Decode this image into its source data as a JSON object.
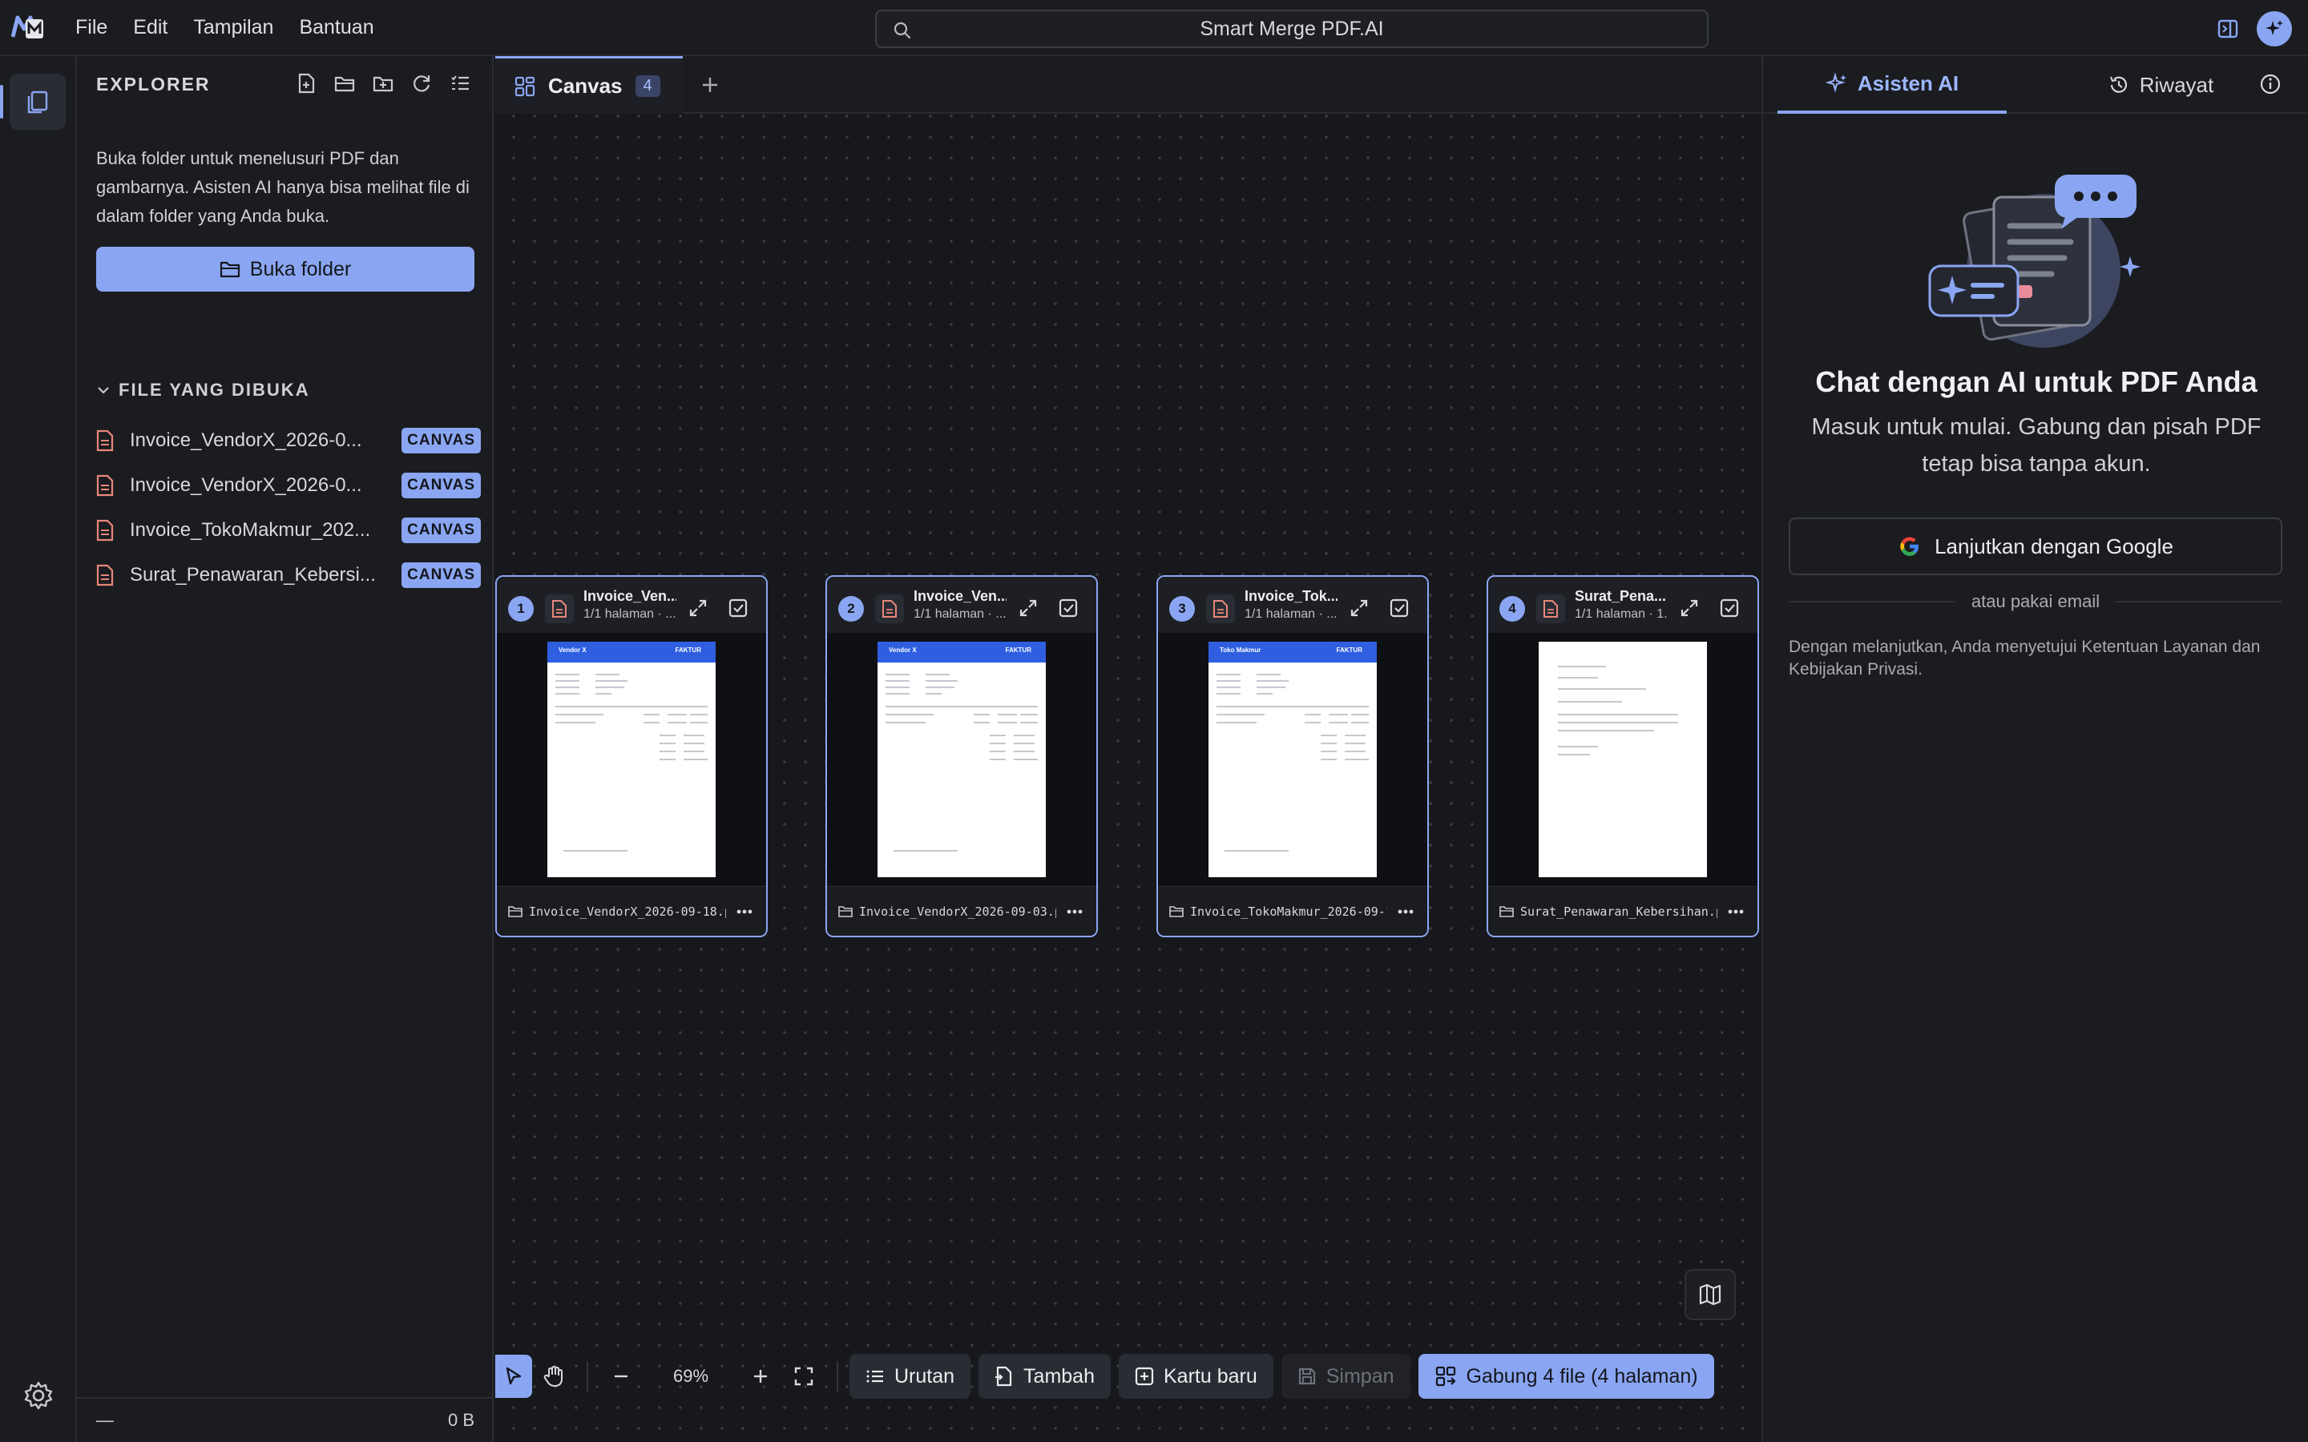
{
  "menu": {
    "items": [
      "File",
      "Edit",
      "Tampilan",
      "Bantuan"
    ]
  },
  "search": {
    "label": "Smart Merge PDF.AI"
  },
  "explorer": {
    "title": "EXPLORER",
    "description": "Buka folder untuk menelusuri PDF dan gambarnya. Asisten AI hanya bisa melihat file di dalam folder yang Anda buka.",
    "open_button": "Buka folder",
    "section_title": "FILE YANG DIBUKA",
    "files": [
      {
        "name": "Invoice_VendorX_2026-0...",
        "badge": "CANVAS"
      },
      {
        "name": "Invoice_VendorX_2026-0...",
        "badge": "CANVAS"
      },
      {
        "name": "Invoice_TokoMakmur_202...",
        "badge": "CANVAS"
      },
      {
        "name": "Surat_Penawaran_Kebersi...",
        "badge": "CANVAS"
      }
    ],
    "status_left": "—",
    "status_right": "0 B"
  },
  "canvas": {
    "tab_label": "Canvas",
    "tab_count": "4",
    "cards": [
      {
        "num": "1",
        "title": "Invoice_Ven...",
        "sub": "1/1 halaman · ...",
        "file": "Invoice_VendorX_2026-09-18.p...",
        "kind": "invoice",
        "brand": "Vendor X",
        "doc": "FAKTUR"
      },
      {
        "num": "2",
        "title": "Invoice_Ven...",
        "sub": "1/1 halaman · ...",
        "file": "Invoice_VendorX_2026-09-03.p...",
        "kind": "invoice",
        "brand": "Vendor X",
        "doc": "FAKTUR"
      },
      {
        "num": "3",
        "title": "Invoice_Tok...",
        "sub": "1/1 halaman · ...",
        "file": "Invoice_TokoMakmur_2026-09-1...",
        "kind": "invoice",
        "brand": "Toko Makmur",
        "doc": "FAKTUR"
      },
      {
        "num": "4",
        "title": "Surat_Pena...",
        "sub": "1/1 halaman · 1...",
        "file": "Surat_Penawaran_Kebersihan.p...",
        "kind": "letter",
        "brand": "",
        "doc": ""
      }
    ],
    "zoom": "69%",
    "buttons": {
      "order": "Urutan",
      "add": "Tambah",
      "new_card": "Kartu baru",
      "save": "Simpan",
      "merge": "Gabung 4 file (4 halaman)"
    }
  },
  "right_panel": {
    "tab_ai": "Asisten AI",
    "tab_history": "Riwayat",
    "title": "Chat dengan AI untuk PDF Anda",
    "subtitle": "Masuk untuk mulai. Gabung dan pisah PDF tetap bisa tanpa akun.",
    "google_button": "Lanjutkan dengan Google",
    "divider": "atau pakai email",
    "terms": "Dengan melanjutkan, Anda menyetujui Ketentuan Layanan dan Kebijakan Privasi."
  },
  "colors": {
    "accent": "#8aa6f2",
    "background": "#1b1c20",
    "canvas": "#17181c"
  }
}
